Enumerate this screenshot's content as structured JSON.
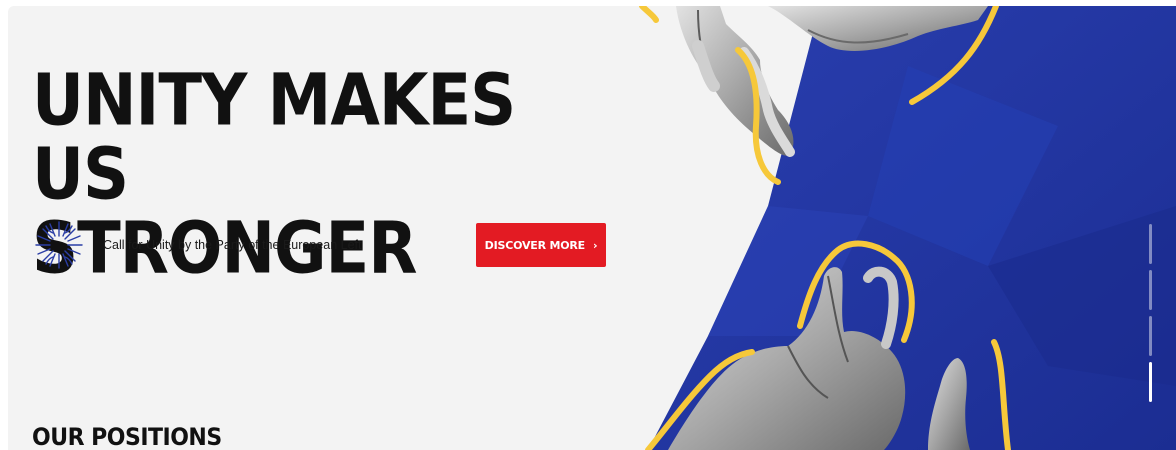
{
  "hero": {
    "headline_line1": "UNITY MAKES US",
    "headline_line2": "STRONGER",
    "logo_caption": "Call for Unity by the Party of the European Left",
    "cta_label": "DISCOVER MORE",
    "cta_icon": "chevron-right-icon",
    "slide_count": 4,
    "active_slide": 4
  },
  "section": {
    "title": "OUR POSITIONS"
  },
  "colors": {
    "background": "#f3f3f3",
    "accent_red": "#e31b23",
    "blue_panel": "#2136a3",
    "yellow_lines": "#f6c83a",
    "text": "#111111",
    "logo_blue": "#2b3ea6"
  }
}
